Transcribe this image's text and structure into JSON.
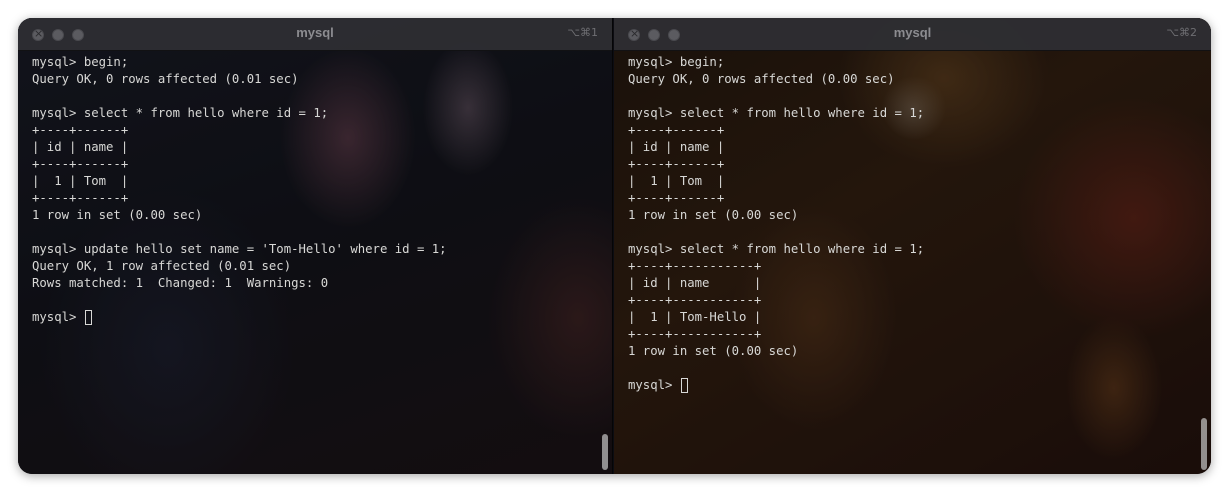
{
  "left": {
    "title": "mysql",
    "shortcut": "⌥⌘1",
    "lines": [
      "mysql> begin;",
      "Query OK, 0 rows affected (0.01 sec)",
      "",
      "mysql> select * from hello where id = 1;",
      "+----+------+",
      "| id | name |",
      "+----+------+",
      "|  1 | Tom  |",
      "+----+------+",
      "1 row in set (0.00 sec)",
      "",
      "mysql> update hello set name = 'Tom-Hello' where id = 1;",
      "Query OK, 1 row affected (0.01 sec)",
      "Rows matched: 1  Changed: 1  Warnings: 0",
      ""
    ],
    "prompt": "mysql> "
  },
  "right": {
    "title": "mysql",
    "shortcut": "⌥⌘2",
    "lines": [
      "mysql> begin;",
      "Query OK, 0 rows affected (0.00 sec)",
      "",
      "mysql> select * from hello where id = 1;",
      "+----+------+",
      "| id | name |",
      "+----+------+",
      "|  1 | Tom  |",
      "+----+------+",
      "1 row in set (0.00 sec)",
      "",
      "mysql> select * from hello where id = 1;",
      "+----+-----------+",
      "| id | name      |",
      "+----+-----------+",
      "|  1 | Tom-Hello |",
      "+----+-----------+",
      "1 row in set (0.00 sec)",
      ""
    ],
    "prompt": "mysql> "
  }
}
